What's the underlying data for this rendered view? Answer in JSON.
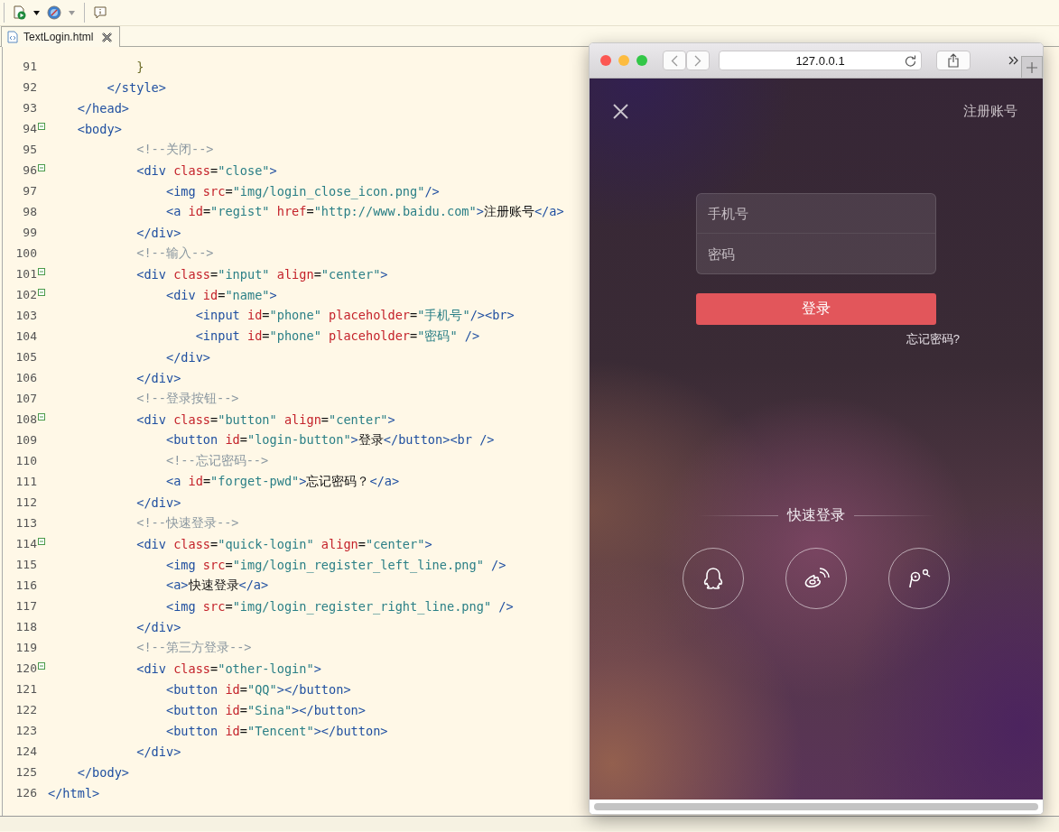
{
  "editor_tab": {
    "title": "TextLogin.html",
    "selected": true
  },
  "code_lines": [
    {
      "number": "91",
      "foldable": false,
      "tokens": [
        {
          "kind": "brace",
          "text": "            }"
        }
      ]
    },
    {
      "number": "92",
      "foldable": false,
      "tokens": [
        {
          "kind": "tag",
          "text": "        </style>"
        }
      ]
    },
    {
      "number": "93",
      "foldable": false,
      "tokens": [
        {
          "kind": "tag",
          "text": "    </head>"
        }
      ]
    },
    {
      "number": "94",
      "foldable": true,
      "tokens": [
        {
          "kind": "tag",
          "text": "    <body>"
        }
      ]
    },
    {
      "number": "95",
      "foldable": false,
      "tokens": [
        {
          "kind": "comment",
          "text": "            <!--关闭-->"
        }
      ]
    },
    {
      "number": "96",
      "foldable": true,
      "tokens": [
        {
          "kind": "tag",
          "text": "            <div"
        },
        {
          "kind": "attr",
          "text": " class"
        },
        {
          "kind": "plain",
          "text": "="
        },
        {
          "kind": "value",
          "text": "\"close\""
        },
        {
          "kind": "tag",
          "text": ">"
        }
      ]
    },
    {
      "number": "97",
      "foldable": false,
      "tokens": [
        {
          "kind": "tag",
          "text": "                <img"
        },
        {
          "kind": "attr",
          "text": " src"
        },
        {
          "kind": "plain",
          "text": "="
        },
        {
          "kind": "value",
          "text": "\"img/login_close_icon.png\""
        },
        {
          "kind": "tag",
          "text": "/>"
        }
      ]
    },
    {
      "number": "98",
      "foldable": false,
      "tokens": [
        {
          "kind": "tag",
          "text": "                <a"
        },
        {
          "kind": "attr",
          "text": " id"
        },
        {
          "kind": "plain",
          "text": "="
        },
        {
          "kind": "value",
          "text": "\"regist\""
        },
        {
          "kind": "attr",
          "text": " href"
        },
        {
          "kind": "plain",
          "text": "="
        },
        {
          "kind": "value",
          "text": "\"http://www.baidu.com\""
        },
        {
          "kind": "tag",
          "text": ">"
        },
        {
          "kind": "plain",
          "text": "注册账号"
        },
        {
          "kind": "tag",
          "text": "</a>"
        }
      ]
    },
    {
      "number": "99",
      "foldable": false,
      "tokens": [
        {
          "kind": "tag",
          "text": "            </div>"
        }
      ]
    },
    {
      "number": "100",
      "foldable": false,
      "tokens": [
        {
          "kind": "comment",
          "text": "            <!--输入-->"
        }
      ]
    },
    {
      "number": "101",
      "foldable": true,
      "tokens": [
        {
          "kind": "tag",
          "text": "            <div"
        },
        {
          "kind": "attr",
          "text": " class"
        },
        {
          "kind": "plain",
          "text": "="
        },
        {
          "kind": "value",
          "text": "\"input\""
        },
        {
          "kind": "attr",
          "text": " align"
        },
        {
          "kind": "plain",
          "text": "="
        },
        {
          "kind": "value",
          "text": "\"center\""
        },
        {
          "kind": "tag",
          "text": ">"
        }
      ]
    },
    {
      "number": "102",
      "foldable": true,
      "tokens": [
        {
          "kind": "tag",
          "text": "                <div"
        },
        {
          "kind": "attr",
          "text": " id"
        },
        {
          "kind": "plain",
          "text": "="
        },
        {
          "kind": "value",
          "text": "\"name\""
        },
        {
          "kind": "tag",
          "text": ">"
        }
      ]
    },
    {
      "number": "103",
      "foldable": false,
      "tokens": [
        {
          "kind": "tag",
          "text": "                    <input"
        },
        {
          "kind": "attr",
          "text": " id"
        },
        {
          "kind": "plain",
          "text": "="
        },
        {
          "kind": "value",
          "text": "\"phone\""
        },
        {
          "kind": "attr",
          "text": " placeholder"
        },
        {
          "kind": "plain",
          "text": "="
        },
        {
          "kind": "value",
          "text": "\"手机号\""
        },
        {
          "kind": "tag",
          "text": "/><br>"
        }
      ]
    },
    {
      "number": "104",
      "foldable": false,
      "tokens": [
        {
          "kind": "tag",
          "text": "                    <input"
        },
        {
          "kind": "attr",
          "text": " id"
        },
        {
          "kind": "plain",
          "text": "="
        },
        {
          "kind": "value",
          "text": "\"phone\""
        },
        {
          "kind": "attr",
          "text": " placeholder"
        },
        {
          "kind": "plain",
          "text": "="
        },
        {
          "kind": "value",
          "text": "\"密码\""
        },
        {
          "kind": "tag",
          "text": " />"
        }
      ]
    },
    {
      "number": "105",
      "foldable": false,
      "tokens": [
        {
          "kind": "tag",
          "text": "                </div>"
        }
      ]
    },
    {
      "number": "106",
      "foldable": false,
      "tokens": [
        {
          "kind": "tag",
          "text": "            </div>"
        }
      ]
    },
    {
      "number": "107",
      "foldable": false,
      "tokens": [
        {
          "kind": "comment",
          "text": "            <!--登录按钮-->"
        }
      ]
    },
    {
      "number": "108",
      "foldable": true,
      "tokens": [
        {
          "kind": "tag",
          "text": "            <div"
        },
        {
          "kind": "attr",
          "text": " class"
        },
        {
          "kind": "plain",
          "text": "="
        },
        {
          "kind": "value",
          "text": "\"button\""
        },
        {
          "kind": "attr",
          "text": " align"
        },
        {
          "kind": "plain",
          "text": "="
        },
        {
          "kind": "value",
          "text": "\"center\""
        },
        {
          "kind": "tag",
          "text": ">"
        }
      ]
    },
    {
      "number": "109",
      "foldable": false,
      "tokens": [
        {
          "kind": "tag",
          "text": "                <button"
        },
        {
          "kind": "attr",
          "text": " id"
        },
        {
          "kind": "plain",
          "text": "="
        },
        {
          "kind": "value",
          "text": "\"login-button\""
        },
        {
          "kind": "tag",
          "text": ">"
        },
        {
          "kind": "plain",
          "text": "登录"
        },
        {
          "kind": "tag",
          "text": "</button><br />"
        }
      ]
    },
    {
      "number": "110",
      "foldable": false,
      "tokens": [
        {
          "kind": "comment",
          "text": "                <!--忘记密码-->"
        }
      ]
    },
    {
      "number": "111",
      "foldable": false,
      "tokens": [
        {
          "kind": "tag",
          "text": "                <a"
        },
        {
          "kind": "attr",
          "text": " id"
        },
        {
          "kind": "plain",
          "text": "="
        },
        {
          "kind": "value",
          "text": "\"forget-pwd\""
        },
        {
          "kind": "tag",
          "text": ">"
        },
        {
          "kind": "plain",
          "text": "忘记密码？"
        },
        {
          "kind": "tag",
          "text": "</a>"
        }
      ]
    },
    {
      "number": "112",
      "foldable": false,
      "tokens": [
        {
          "kind": "tag",
          "text": "            </div>"
        }
      ]
    },
    {
      "number": "113",
      "foldable": false,
      "tokens": [
        {
          "kind": "comment",
          "text": "            <!--快速登录-->"
        }
      ]
    },
    {
      "number": "114",
      "foldable": true,
      "tokens": [
        {
          "kind": "tag",
          "text": "            <div"
        },
        {
          "kind": "attr",
          "text": " class"
        },
        {
          "kind": "plain",
          "text": "="
        },
        {
          "kind": "value",
          "text": "\"quick-login\""
        },
        {
          "kind": "attr",
          "text": " align"
        },
        {
          "kind": "plain",
          "text": "="
        },
        {
          "kind": "value",
          "text": "\"center\""
        },
        {
          "kind": "tag",
          "text": ">"
        }
      ]
    },
    {
      "number": "115",
      "foldable": false,
      "tokens": [
        {
          "kind": "tag",
          "text": "                <img"
        },
        {
          "kind": "attr",
          "text": " src"
        },
        {
          "kind": "plain",
          "text": "="
        },
        {
          "kind": "value",
          "text": "\"img/login_register_left_line.png\""
        },
        {
          "kind": "tag",
          "text": " />"
        }
      ]
    },
    {
      "number": "116",
      "foldable": false,
      "tokens": [
        {
          "kind": "tag",
          "text": "                <a>"
        },
        {
          "kind": "plain",
          "text": "快速登录"
        },
        {
          "kind": "tag",
          "text": "</a>"
        }
      ]
    },
    {
      "number": "117",
      "foldable": false,
      "tokens": [
        {
          "kind": "tag",
          "text": "                <img"
        },
        {
          "kind": "attr",
          "text": " src"
        },
        {
          "kind": "plain",
          "text": "="
        },
        {
          "kind": "value",
          "text": "\"img/login_register_right_line.png\""
        },
        {
          "kind": "tag",
          "text": " />"
        }
      ]
    },
    {
      "number": "118",
      "foldable": false,
      "tokens": [
        {
          "kind": "tag",
          "text": "            </div>"
        }
      ]
    },
    {
      "number": "119",
      "foldable": false,
      "tokens": [
        {
          "kind": "comment",
          "text": "            <!--第三方登录-->"
        }
      ]
    },
    {
      "number": "120",
      "foldable": true,
      "tokens": [
        {
          "kind": "tag",
          "text": "            <div"
        },
        {
          "kind": "attr",
          "text": " class"
        },
        {
          "kind": "plain",
          "text": "="
        },
        {
          "kind": "value",
          "text": "\"other-login\""
        },
        {
          "kind": "tag",
          "text": ">"
        }
      ]
    },
    {
      "number": "121",
      "foldable": false,
      "tokens": [
        {
          "kind": "tag",
          "text": "                <button"
        },
        {
          "kind": "attr",
          "text": " id"
        },
        {
          "kind": "plain",
          "text": "="
        },
        {
          "kind": "value",
          "text": "\"QQ\""
        },
        {
          "kind": "tag",
          "text": "></button>"
        }
      ]
    },
    {
      "number": "122",
      "foldable": false,
      "tokens": [
        {
          "kind": "tag",
          "text": "                <button"
        },
        {
          "kind": "attr",
          "text": " id"
        },
        {
          "kind": "plain",
          "text": "="
        },
        {
          "kind": "value",
          "text": "\"Sina\""
        },
        {
          "kind": "tag",
          "text": "></button>"
        }
      ]
    },
    {
      "number": "123",
      "foldable": false,
      "tokens": [
        {
          "kind": "tag",
          "text": "                <button"
        },
        {
          "kind": "attr",
          "text": " id"
        },
        {
          "kind": "plain",
          "text": "="
        },
        {
          "kind": "value",
          "text": "\"Tencent\""
        },
        {
          "kind": "tag",
          "text": "></button>"
        }
      ]
    },
    {
      "number": "124",
      "foldable": false,
      "tokens": [
        {
          "kind": "tag",
          "text": "            </div>"
        }
      ]
    },
    {
      "number": "125",
      "foldable": false,
      "tokens": [
        {
          "kind": "tag",
          "text": "    </body>"
        }
      ]
    },
    {
      "number": "126",
      "foldable": false,
      "tokens": [
        {
          "kind": "tag",
          "text": "</html>"
        }
      ]
    }
  ],
  "browser": {
    "address": "127.0.0.1",
    "page": {
      "register_link": "注册账号",
      "fields": [
        {
          "placeholder": "手机号"
        },
        {
          "placeholder": "密码"
        }
      ],
      "login_button": "登录",
      "forgot_link": "忘记密码?",
      "quick_login_title": "快速登录",
      "providers": [
        {
          "kind": "qq"
        },
        {
          "kind": "weibo"
        },
        {
          "kind": "tencent"
        }
      ]
    }
  }
}
